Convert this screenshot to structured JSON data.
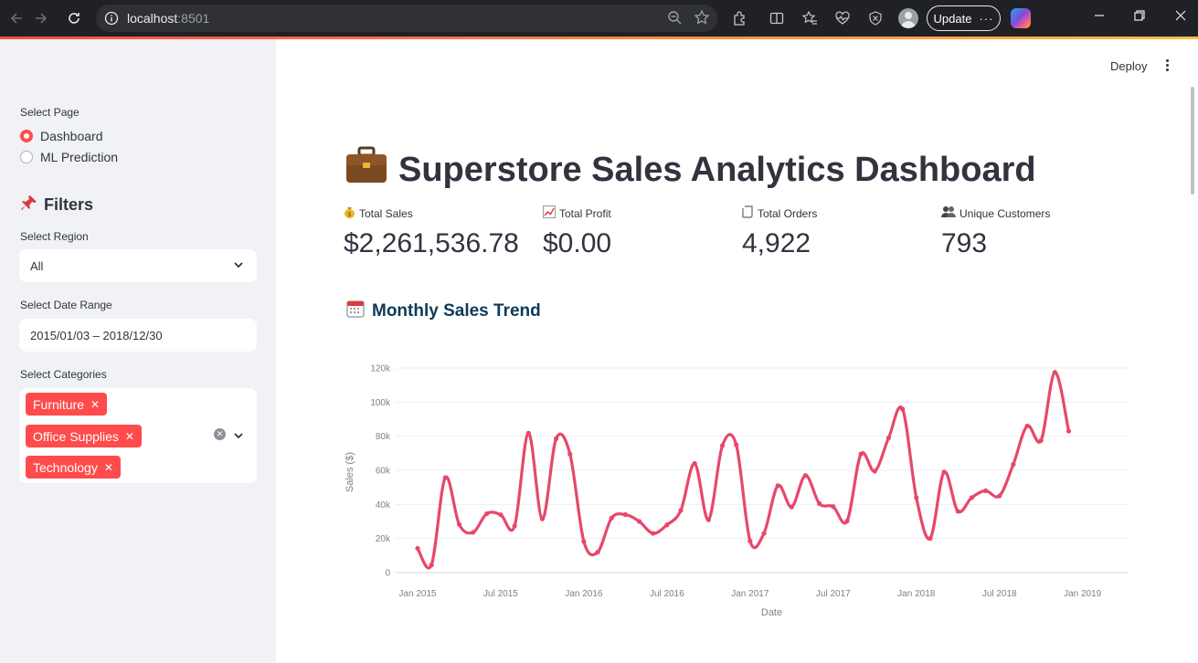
{
  "browser": {
    "url_host": "localhost",
    "url_port": ":8501",
    "update_label": "Update"
  },
  "app": {
    "deploy_label": "Deploy"
  },
  "sidebar": {
    "select_page_label": "Select Page",
    "pages": [
      {
        "label": "Dashboard",
        "selected": true
      },
      {
        "label": "ML Prediction",
        "selected": false
      }
    ],
    "filters_heading": "Filters",
    "region_label": "Select Region",
    "region_value": "All",
    "date_label": "Select Date Range",
    "date_value": "2015/01/03 – 2018/12/30",
    "categories_label": "Select Categories",
    "categories": [
      "Furniture",
      "Office Supplies",
      "Technology"
    ]
  },
  "main": {
    "title": "Superstore Sales Analytics Dashboard",
    "metrics": [
      {
        "icon": "money-bag-icon",
        "label": "Total Sales",
        "value": "$2,261,536.78"
      },
      {
        "icon": "chart-up-icon",
        "label": "Total Profit",
        "value": "$0.00"
      },
      {
        "icon": "scroll-icon",
        "label": "Total Orders",
        "value": "4,922"
      },
      {
        "icon": "people-icon",
        "label": "Unique Customers",
        "value": "793"
      }
    ],
    "trend_heading": "Monthly Sales Trend"
  },
  "chart_data": {
    "type": "line",
    "title": "",
    "xlabel": "Date",
    "ylabel": "Sales ($)",
    "color": "#e8476a",
    "ylim": [
      0,
      120000
    ],
    "yticks": [
      "0",
      "20k",
      "40k",
      "60k",
      "80k",
      "100k",
      "120k"
    ],
    "xticks": [
      "Jan 2015",
      "Jul 2015",
      "Jan 2016",
      "Jul 2016",
      "Jan 2017",
      "Jul 2017",
      "Jan 2018",
      "Jul 2018",
      "Jan 2019"
    ],
    "x": [
      "2015-01",
      "2015-02",
      "2015-03",
      "2015-04",
      "2015-05",
      "2015-06",
      "2015-07",
      "2015-08",
      "2015-09",
      "2015-10",
      "2015-11",
      "2015-12",
      "2016-01",
      "2016-02",
      "2016-03",
      "2016-04",
      "2016-05",
      "2016-06",
      "2016-07",
      "2016-08",
      "2016-09",
      "2016-10",
      "2016-11",
      "2016-12",
      "2017-01",
      "2017-02",
      "2017-03",
      "2017-04",
      "2017-05",
      "2017-06",
      "2017-07",
      "2017-08",
      "2017-09",
      "2017-10",
      "2017-11",
      "2017-12",
      "2018-01",
      "2018-02",
      "2018-03",
      "2018-04",
      "2018-05",
      "2018-06",
      "2018-07",
      "2018-08",
      "2018-09",
      "2018-10",
      "2018-11",
      "2018-12"
    ],
    "values": [
      14200,
      4500,
      55700,
      28300,
      23600,
      34600,
      33900,
      27300,
      81800,
      31500,
      78600,
      69500,
      18200,
      12000,
      32000,
      34000,
      30000,
      23000,
      28000,
      36500,
      64000,
      31000,
      74500,
      75000,
      18500,
      23000,
      51000,
      38500,
      57000,
      40500,
      38700,
      30200,
      69500,
      59500,
      79000,
      96000,
      44000,
      20000,
      59000,
      36000,
      44000,
      48000,
      45000,
      63500,
      86000,
      77500,
      117500,
      83000
    ]
  }
}
